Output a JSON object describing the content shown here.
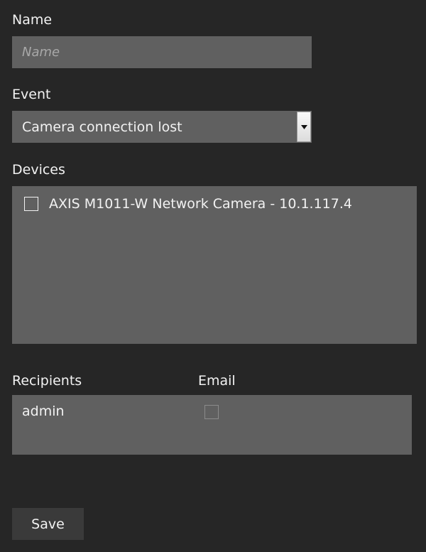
{
  "form": {
    "name_label": "Name",
    "name_placeholder": "Name",
    "name_value": "",
    "event_label": "Event",
    "event_selected": "Camera connection lost",
    "devices_label": "Devices",
    "devices": [
      {
        "label": "AXIS M1011-W Network Camera - 10.1.117.4",
        "checked": false
      }
    ],
    "recipients_label": "Recipients",
    "email_label": "Email",
    "recipients": [
      {
        "name": "admin",
        "email": false
      }
    ],
    "save_label": "Save"
  },
  "colors": {
    "background": "#262626",
    "field": "#606060",
    "button": "#3a3a3a",
    "text": "#f2f2f2"
  }
}
